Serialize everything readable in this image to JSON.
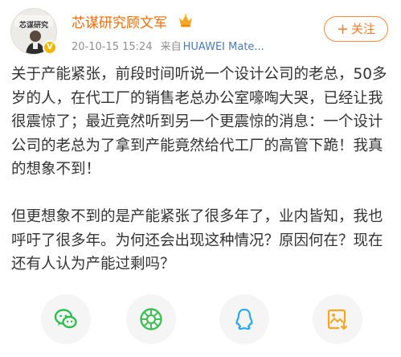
{
  "author": {
    "name": "芯谋研究顾文军",
    "avatar_text": "芯谋研究",
    "verified_badge": "V"
  },
  "meta": {
    "timestamp": "20-10-15 15:24",
    "source_prefix": "来自",
    "device": "HUAWEI Mate..."
  },
  "follow": {
    "plus": "+",
    "label": "关注"
  },
  "post": {
    "paragraphs": [
      "关于产能紧张，前段时间听说一个设计公司的老总，50多岁的人，在代工厂的销售老总办公室嚎啕大哭，已经让我很震惊了；最近竟然听到另一个更震惊的消息：一个设计公司的老总为了拿到产能竟然给代工厂的高管下跪！我真的想象不到！",
      "但更想象不到的是产能紧张了很多年了，业内皆知，我也呼吁了很多年。为何还会出现这种情况？原因何在？现在还有人认为产能过剩吗？"
    ]
  },
  "share": [
    {
      "icon": "wechat-icon",
      "color": "#2dbe4f"
    },
    {
      "icon": "moments-icon",
      "color": "#40c057"
    },
    {
      "icon": "qq-icon",
      "color": "#2aa8f0"
    },
    {
      "icon": "save-image-icon",
      "color": "#f5a623"
    }
  ],
  "colors": {
    "author_name": "#f76b00",
    "follow_accent": "#ff7a26",
    "device_link": "#4a7ab5",
    "meta_gray": "#8f8f8f"
  }
}
